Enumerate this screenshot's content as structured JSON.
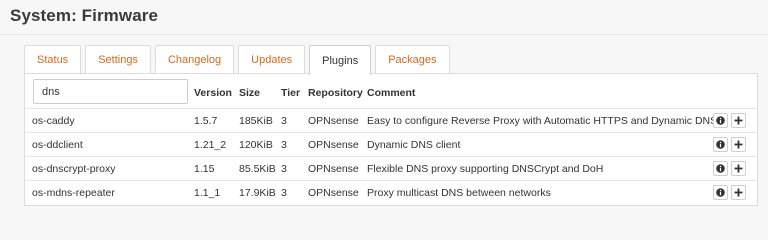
{
  "page": {
    "title": "System: Firmware"
  },
  "tabs": [
    "Status",
    "Settings",
    "Changelog",
    "Updates",
    "Plugins",
    "Packages"
  ],
  "active_tab": "Plugins",
  "search": {
    "value": "dns",
    "placeholder": ""
  },
  "table": {
    "headers": {
      "version": "Version",
      "size": "Size",
      "tier": "Tier",
      "repository": "Repository",
      "comment": "Comment"
    },
    "rows": [
      {
        "name": "os-caddy",
        "version": "1.5.7",
        "size": "185KiB",
        "tier": "3",
        "repository": "OPNsense",
        "comment": "Easy to configure Reverse Proxy with Automatic HTTPS and Dynamic DNS"
      },
      {
        "name": "os-ddclient",
        "version": "1.21_2",
        "size": "120KiB",
        "tier": "3",
        "repository": "OPNsense",
        "comment": "Dynamic DNS client"
      },
      {
        "name": "os-dnscrypt-proxy",
        "version": "1.15",
        "size": "85.5KiB",
        "tier": "3",
        "repository": "OPNsense",
        "comment": "Flexible DNS proxy supporting DNSCrypt and DoH"
      },
      {
        "name": "os-mdns-repeater",
        "version": "1.1_1",
        "size": "17.9KiB",
        "tier": "3",
        "repository": "OPNsense",
        "comment": "Proxy multicast DNS between networks"
      }
    ]
  },
  "icons": {
    "info": "info-icon",
    "install": "plus-icon"
  },
  "colors": {
    "accent": "#d4691e",
    "text": "#333333",
    "border": "#dcdcdc"
  }
}
